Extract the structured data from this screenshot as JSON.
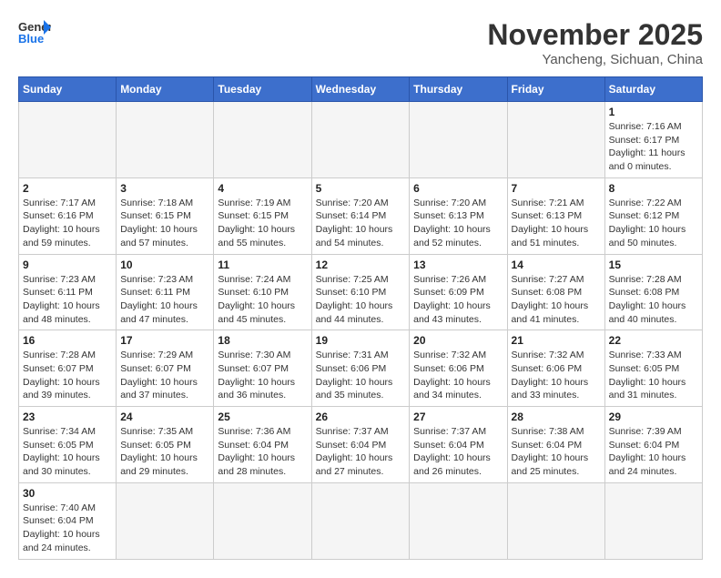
{
  "header": {
    "logo_general": "General",
    "logo_blue": "Blue",
    "month_title": "November 2025",
    "location": "Yancheng, Sichuan, China"
  },
  "days_of_week": [
    "Sunday",
    "Monday",
    "Tuesday",
    "Wednesday",
    "Thursday",
    "Friday",
    "Saturday"
  ],
  "weeks": [
    [
      {
        "day": "",
        "info": ""
      },
      {
        "day": "",
        "info": ""
      },
      {
        "day": "",
        "info": ""
      },
      {
        "day": "",
        "info": ""
      },
      {
        "day": "",
        "info": ""
      },
      {
        "day": "",
        "info": ""
      },
      {
        "day": "1",
        "info": "Sunrise: 7:16 AM\nSunset: 6:17 PM\nDaylight: 11 hours and 0 minutes."
      }
    ],
    [
      {
        "day": "2",
        "info": "Sunrise: 7:17 AM\nSunset: 6:16 PM\nDaylight: 10 hours and 59 minutes."
      },
      {
        "day": "3",
        "info": "Sunrise: 7:18 AM\nSunset: 6:15 PM\nDaylight: 10 hours and 57 minutes."
      },
      {
        "day": "4",
        "info": "Sunrise: 7:19 AM\nSunset: 6:15 PM\nDaylight: 10 hours and 55 minutes."
      },
      {
        "day": "5",
        "info": "Sunrise: 7:20 AM\nSunset: 6:14 PM\nDaylight: 10 hours and 54 minutes."
      },
      {
        "day": "6",
        "info": "Sunrise: 7:20 AM\nSunset: 6:13 PM\nDaylight: 10 hours and 52 minutes."
      },
      {
        "day": "7",
        "info": "Sunrise: 7:21 AM\nSunset: 6:13 PM\nDaylight: 10 hours and 51 minutes."
      },
      {
        "day": "8",
        "info": "Sunrise: 7:22 AM\nSunset: 6:12 PM\nDaylight: 10 hours and 50 minutes."
      }
    ],
    [
      {
        "day": "9",
        "info": "Sunrise: 7:23 AM\nSunset: 6:11 PM\nDaylight: 10 hours and 48 minutes."
      },
      {
        "day": "10",
        "info": "Sunrise: 7:23 AM\nSunset: 6:11 PM\nDaylight: 10 hours and 47 minutes."
      },
      {
        "day": "11",
        "info": "Sunrise: 7:24 AM\nSunset: 6:10 PM\nDaylight: 10 hours and 45 minutes."
      },
      {
        "day": "12",
        "info": "Sunrise: 7:25 AM\nSunset: 6:10 PM\nDaylight: 10 hours and 44 minutes."
      },
      {
        "day": "13",
        "info": "Sunrise: 7:26 AM\nSunset: 6:09 PM\nDaylight: 10 hours and 43 minutes."
      },
      {
        "day": "14",
        "info": "Sunrise: 7:27 AM\nSunset: 6:08 PM\nDaylight: 10 hours and 41 minutes."
      },
      {
        "day": "15",
        "info": "Sunrise: 7:28 AM\nSunset: 6:08 PM\nDaylight: 10 hours and 40 minutes."
      }
    ],
    [
      {
        "day": "16",
        "info": "Sunrise: 7:28 AM\nSunset: 6:07 PM\nDaylight: 10 hours and 39 minutes."
      },
      {
        "day": "17",
        "info": "Sunrise: 7:29 AM\nSunset: 6:07 PM\nDaylight: 10 hours and 37 minutes."
      },
      {
        "day": "18",
        "info": "Sunrise: 7:30 AM\nSunset: 6:07 PM\nDaylight: 10 hours and 36 minutes."
      },
      {
        "day": "19",
        "info": "Sunrise: 7:31 AM\nSunset: 6:06 PM\nDaylight: 10 hours and 35 minutes."
      },
      {
        "day": "20",
        "info": "Sunrise: 7:32 AM\nSunset: 6:06 PM\nDaylight: 10 hours and 34 minutes."
      },
      {
        "day": "21",
        "info": "Sunrise: 7:32 AM\nSunset: 6:06 PM\nDaylight: 10 hours and 33 minutes."
      },
      {
        "day": "22",
        "info": "Sunrise: 7:33 AM\nSunset: 6:05 PM\nDaylight: 10 hours and 31 minutes."
      }
    ],
    [
      {
        "day": "23",
        "info": "Sunrise: 7:34 AM\nSunset: 6:05 PM\nDaylight: 10 hours and 30 minutes."
      },
      {
        "day": "24",
        "info": "Sunrise: 7:35 AM\nSunset: 6:05 PM\nDaylight: 10 hours and 29 minutes."
      },
      {
        "day": "25",
        "info": "Sunrise: 7:36 AM\nSunset: 6:04 PM\nDaylight: 10 hours and 28 minutes."
      },
      {
        "day": "26",
        "info": "Sunrise: 7:37 AM\nSunset: 6:04 PM\nDaylight: 10 hours and 27 minutes."
      },
      {
        "day": "27",
        "info": "Sunrise: 7:37 AM\nSunset: 6:04 PM\nDaylight: 10 hours and 26 minutes."
      },
      {
        "day": "28",
        "info": "Sunrise: 7:38 AM\nSunset: 6:04 PM\nDaylight: 10 hours and 25 minutes."
      },
      {
        "day": "29",
        "info": "Sunrise: 7:39 AM\nSunset: 6:04 PM\nDaylight: 10 hours and 24 minutes."
      }
    ],
    [
      {
        "day": "30",
        "info": "Sunrise: 7:40 AM\nSunset: 6:04 PM\nDaylight: 10 hours and 24 minutes."
      },
      {
        "day": "",
        "info": ""
      },
      {
        "day": "",
        "info": ""
      },
      {
        "day": "",
        "info": ""
      },
      {
        "day": "",
        "info": ""
      },
      {
        "day": "",
        "info": ""
      },
      {
        "day": "",
        "info": ""
      }
    ]
  ]
}
